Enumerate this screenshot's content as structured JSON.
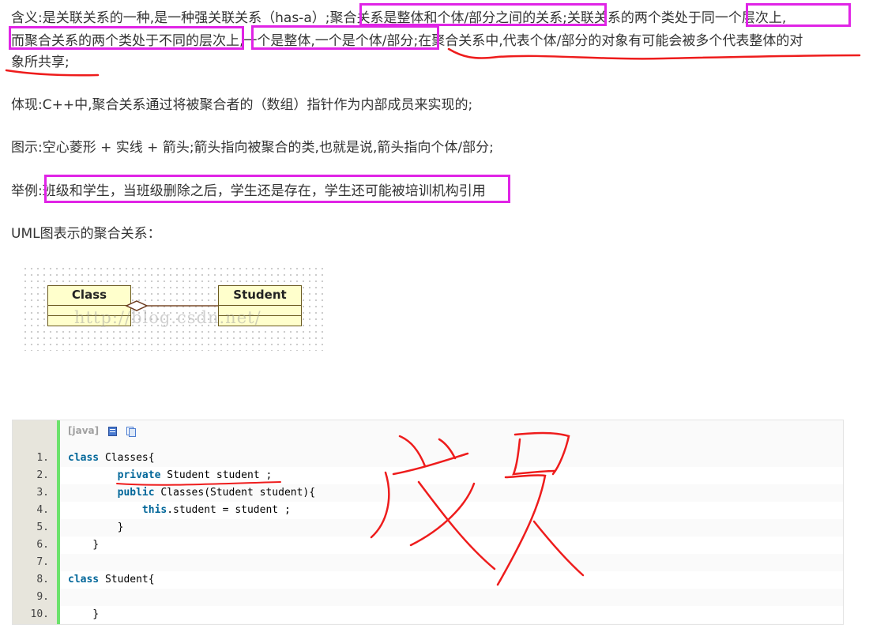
{
  "paragraphs": {
    "def_line1": "  含义:是关联关系的一种,是一种强关联关系（has-a）;聚合关系是整体和个体/部分之间的关系;关联关系的两个类处于同一个层次上,",
    "def_line2": "而聚合关系的两个类处于不同的层次上,一个是整体,一个是个体/部分;在聚合关系中,代表个体/部分的对象有可能会被多个代表整体的对",
    "def_line3": "象所共享;",
    "embody": "体现:C++中,聚合关系通过将被聚合者的（数组）指针作为内部成员来实现的;",
    "diagram": "图示:空心菱形 + 实线 + 箭头;箭头指向被聚合的类,也就是说,箭头指向个体/部分;",
    "example": "举例:班级和学生，当班级删除之后，学生还是存在，学生还可能被培训机构引用",
    "uml_caption": "UML图表示的聚合关系："
  },
  "uml": {
    "left_class": "Class",
    "right_class": "Student",
    "watermark": "http://blog.csdn.net/"
  },
  "code": {
    "lang_label": "[java]",
    "icons": [
      "view-source-icon",
      "copy-icon"
    ],
    "lines": [
      {
        "no": "1.",
        "text": "class Classes{"
      },
      {
        "no": "2.",
        "text": "        private Student student ;"
      },
      {
        "no": "3.",
        "text": "        public Classes(Student student){"
      },
      {
        "no": "4.",
        "text": "            this.student = student ;"
      },
      {
        "no": "5.",
        "text": "        }"
      },
      {
        "no": "6.",
        "text": "    }"
      },
      {
        "no": "7.",
        "text": ""
      },
      {
        "no": "8.",
        "text": "class Student{"
      },
      {
        "no": "9.",
        "text": ""
      },
      {
        "no": "10.",
        "text": "    }"
      }
    ]
  },
  "handwritten_note": "成员",
  "colors": {
    "highlight_box": "#e024e6",
    "red_ink": "#ee1c1c",
    "keyword": "#006699",
    "gutter_bar": "#6ce26c"
  }
}
